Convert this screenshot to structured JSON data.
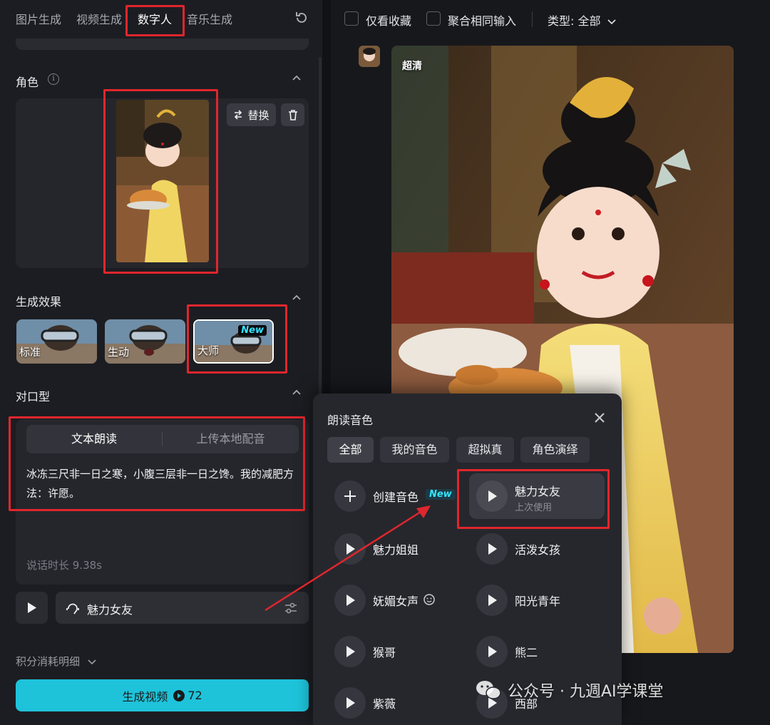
{
  "tabs": [
    {
      "label": "图片生成"
    },
    {
      "label": "视频生成"
    },
    {
      "label": "数字人"
    },
    {
      "label": "音乐生成"
    }
  ],
  "role": {
    "title": "角色",
    "replace_label": "替换"
  },
  "effects": {
    "title": "生成效果",
    "items": [
      {
        "label": "标准"
      },
      {
        "label": "生动"
      },
      {
        "label": "大师",
        "badge": "New"
      }
    ]
  },
  "lipsync": {
    "title": "对口型",
    "mode_text": "文本朗读",
    "mode_upload": "上传本地配音",
    "script": "冰冻三尺非一日之寒，小腹三层非一日之馋。我的减肥方法：许愿。",
    "duration": "说话时长 9.38s",
    "voice_selected": "魅力女友"
  },
  "footer": {
    "cost_label": "积分消耗明细",
    "generate_label": "生成视频",
    "generate_cost": "72"
  },
  "right_toolbar": {
    "favorites_label": "仅看收藏",
    "merge_label": "聚合相同输入",
    "type_label": "类型: 全部"
  },
  "preview": {
    "quality_badge": "超清"
  },
  "voice_popup": {
    "title": "朗读音色",
    "filters": [
      "全部",
      "我的音色",
      "超拟真",
      "角色演绎"
    ],
    "create_label": "创建音色",
    "create_badge": "New",
    "last_used": {
      "name": "魅力女友",
      "sub": "上次使用"
    },
    "voices": [
      "魅力姐姐",
      "活泼女孩",
      "妩媚女声",
      "阳光青年",
      "猴哥",
      "熊二",
      "紫薇",
      "西部"
    ]
  },
  "watermark": {
    "text": "公众号 · 九週AI学课堂"
  },
  "colors": {
    "accent": "#1ec3da",
    "highlight_box": "#e0262d",
    "panel": "#1c1d22",
    "new_badge": "#34e4ff"
  }
}
